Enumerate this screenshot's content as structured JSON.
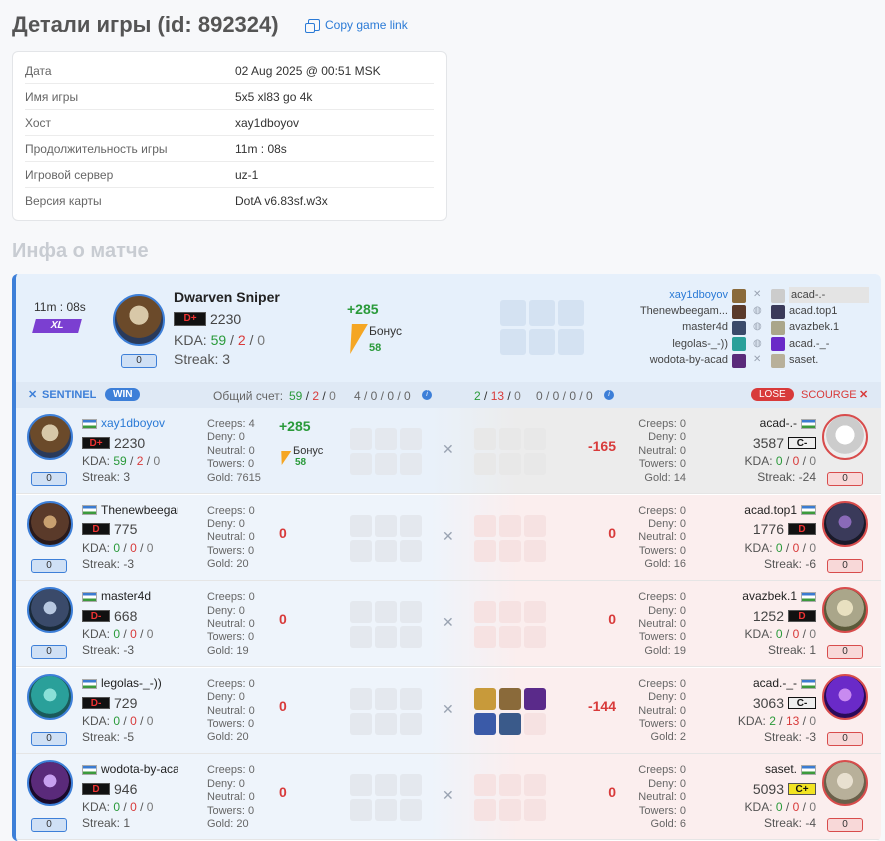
{
  "page_title": "Детали игры (id: 892324)",
  "copy_link": "Copy game link",
  "details": [
    {
      "k": "Дата",
      "v": "02 Aug 2025 @ 00:51 MSK"
    },
    {
      "k": "Имя игры",
      "v": "5x5 xl83 go 4k"
    },
    {
      "k": "Хост",
      "v": "xay1dboyov"
    },
    {
      "k": "Продолжительность игры",
      "v": "11m : 08s"
    },
    {
      "k": "Игровой сервер",
      "v": "uz-1"
    },
    {
      "k": "Версия карты",
      "v": "DotA v6.83sf.w3x"
    }
  ],
  "section_title": "Инфа о матче",
  "summary": {
    "duration": "11m : 08s",
    "mode": "XL",
    "pill": "0",
    "hero": "Dwarven Sniper",
    "rank": "D+",
    "mmr": "2230",
    "kda_label": "KDA:",
    "k": "59",
    "d": "2",
    "a": "0",
    "streak": "Streak: 3",
    "points": "+285",
    "bonus_label": "Бонус",
    "bonus": "58",
    "sentinel_players": [
      "xay1dboyov",
      "Thenewbeegam...",
      "master4d",
      "legolas-_-))",
      "wodota-by-acad"
    ],
    "scourge_players": [
      "acad-.-",
      "acad.top1",
      "avazbek.1",
      "acad.-_-",
      "saset."
    ]
  },
  "teambar": {
    "sentinel": "SENTINEL",
    "win": "WIN",
    "score_label": "Общий счет:",
    "s_k": "59",
    "s_d": "2",
    "s_a": "0",
    "s_rest": "4 / 0 / 0 / 0",
    "e_k": "2",
    "e_d": "13",
    "e_a": "0",
    "e_rest": "0 / 0 / 0 / 0",
    "lose": "LOSE",
    "scourge": "SCOURGE"
  },
  "rows": [
    {
      "l": {
        "name": "xay1dboyov",
        "rank": "D+",
        "mmr": "2230",
        "k": "59",
        "d": "2",
        "a": "0",
        "streak": "Streak: 3",
        "pill": "0",
        "creeps": "Creeps: 4",
        "deny": "Deny: 0",
        "neutral": "Neutral: 0",
        "towers": "Towers: 0",
        "gold": "Gold: 7615",
        "points": "+285",
        "bonus_label": "Бонус",
        "bonus": "58"
      },
      "r": {
        "name": "acad-.-",
        "rank": "C-",
        "mmr": "3587",
        "k": "0",
        "d": "0",
        "a": "0",
        "streak": "Streak: -24",
        "pill": "0",
        "creeps": "Creeps: 0",
        "deny": "Deny: 0",
        "neutral": "Neutral: 0",
        "towers": "Towers: 0",
        "gold": "Gold: 14",
        "points": "-165"
      }
    },
    {
      "l": {
        "name": "Thenewbeegam",
        "rank": "D",
        "mmr": "775",
        "k": "0",
        "d": "0",
        "a": "0",
        "streak": "Streak: -3",
        "pill": "0",
        "creeps": "Creeps: 0",
        "deny": "Deny: 0",
        "neutral": "Neutral: 0",
        "towers": "Towers: 0",
        "gold": "Gold: 20",
        "points": "0"
      },
      "r": {
        "name": "acad.top1",
        "rank": "D",
        "mmr": "1776",
        "k": "0",
        "d": "0",
        "a": "0",
        "streak": "Streak: -6",
        "pill": "0",
        "creeps": "Creeps: 0",
        "deny": "Deny: 0",
        "neutral": "Neutral: 0",
        "towers": "Towers: 0",
        "gold": "Gold: 16",
        "points": "0"
      }
    },
    {
      "l": {
        "name": "master4d",
        "rank": "D-",
        "mmr": "668",
        "k": "0",
        "d": "0",
        "a": "0",
        "streak": "Streak: -3",
        "pill": "0",
        "creeps": "Creeps: 0",
        "deny": "Deny: 0",
        "neutral": "Neutral: 0",
        "towers": "Towers: 0",
        "gold": "Gold: 19",
        "points": "0"
      },
      "r": {
        "name": "avazbek.1",
        "rank": "D",
        "mmr": "1252",
        "k": "0",
        "d": "0",
        "a": "0",
        "streak": "Streak: 1",
        "pill": "0",
        "creeps": "Creeps: 0",
        "deny": "Deny: 0",
        "neutral": "Neutral: 0",
        "towers": "Towers: 0",
        "gold": "Gold: 19",
        "points": "0"
      }
    },
    {
      "l": {
        "name": "legolas-_-))",
        "rank": "D-",
        "mmr": "729",
        "k": "0",
        "d": "0",
        "a": "0",
        "streak": "Streak: -5",
        "pill": "0",
        "creeps": "Creeps: 0",
        "deny": "Deny: 0",
        "neutral": "Neutral: 0",
        "towers": "Towers: 0",
        "gold": "Gold: 20",
        "points": "0"
      },
      "r": {
        "name": "acad.-_-",
        "rank": "C-",
        "mmr": "3063",
        "k": "2",
        "d": "13",
        "a": "0",
        "streak": "Streak: -3",
        "pill": "0",
        "creeps": "Creeps: 0",
        "deny": "Deny: 0",
        "neutral": "Neutral: 0",
        "towers": "Towers: 0",
        "gold": "Gold: 2",
        "points": "-144"
      }
    },
    {
      "l": {
        "name": "wodota-by-acad",
        "rank": "D",
        "mmr": "946",
        "k": "0",
        "d": "0",
        "a": "0",
        "streak": "Streak: 1",
        "pill": "0",
        "creeps": "Creeps: 0",
        "deny": "Deny: 0",
        "neutral": "Neutral: 0",
        "towers": "Towers: 0",
        "gold": "Gold: 20",
        "points": "0"
      },
      "r": {
        "name": "saset.",
        "rank": "C+",
        "mmr": "5093",
        "k": "0",
        "d": "0",
        "a": "0",
        "streak": "Streak: -4",
        "pill": "0",
        "creeps": "Creeps: 0",
        "deny": "Deny: 0",
        "neutral": "Neutral: 0",
        "towers": "Towers: 0",
        "gold": "Gold: 6",
        "points": "0"
      }
    }
  ],
  "kda_label": "KDA:",
  "colors": {
    "accent": "#3d7fd8",
    "win": "#3d7fd8",
    "lose": "#d83a3a",
    "positive": "#2a9a3a",
    "negative": "#d83a3a"
  }
}
